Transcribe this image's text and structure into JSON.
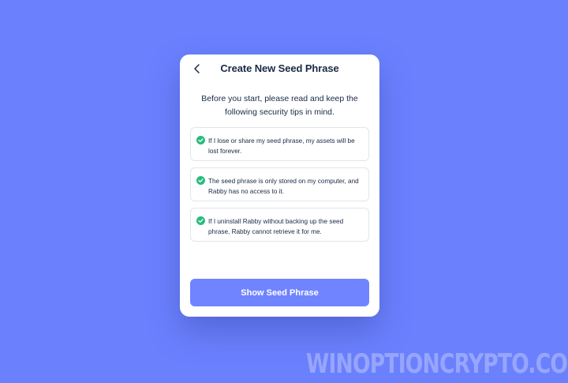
{
  "colors": {
    "background": "#6b80fd",
    "card": "#ffffff",
    "primary_button": "#7084ff",
    "check_icon": "#2abb7f",
    "text": "#192945"
  },
  "header": {
    "back_icon": "chevron-left-icon",
    "title": "Create New Seed Phrase"
  },
  "intro": "Before you start, please read and keep the following security tips in mind.",
  "tips": [
    {
      "icon": "check-circle-icon",
      "text": "If I lose or share my seed phrase, my assets will be lost forever."
    },
    {
      "icon": "check-circle-icon",
      "text": "The seed phrase is only stored on my computer, and Rabby has no access to it."
    },
    {
      "icon": "check-circle-icon",
      "text": "If I uninstall Rabby without backing up the seed phrase, Rabby cannot retrieve it for me."
    }
  ],
  "primary_button": {
    "label": "Show Seed Phrase"
  },
  "watermark": "WINOPTIONCRYPTO.COM"
}
